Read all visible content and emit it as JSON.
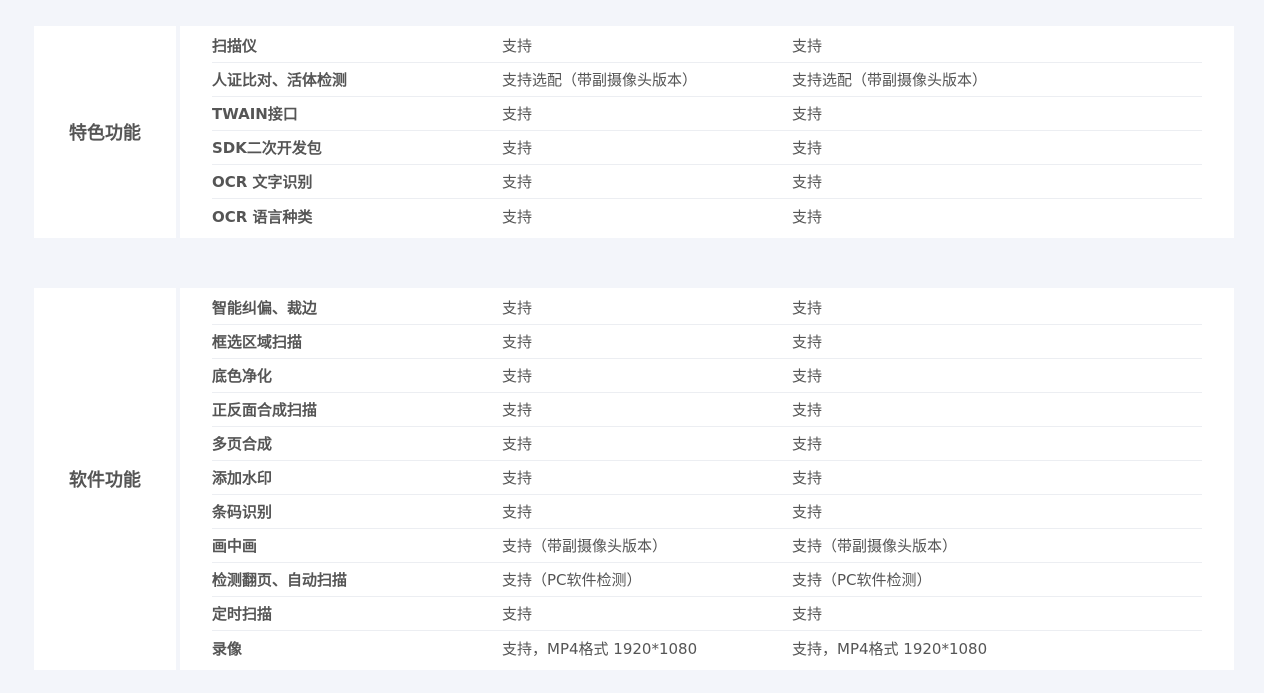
{
  "sections": [
    {
      "label": "特色功能",
      "rows": [
        {
          "name": "扫描仪",
          "a": "支持",
          "b": "支持"
        },
        {
          "name": "人证比对、活体检测",
          "a": "支持选配（带副摄像头版本）",
          "b": "支持选配（带副摄像头版本）"
        },
        {
          "name": "TWAIN接口",
          "a": "支持",
          "b": "支持"
        },
        {
          "name": "SDK二次开发包",
          "a": "支持",
          "b": "支持"
        },
        {
          "name": "OCR 文字识别",
          "a": "支持",
          "b": "支持"
        },
        {
          "name": "OCR 语言种类",
          "a": "支持",
          "b": "支持"
        }
      ]
    },
    {
      "label": "软件功能",
      "rows": [
        {
          "name": "智能纠偏、裁边",
          "a": "支持",
          "b": "支持"
        },
        {
          "name": "框选区域扫描",
          "a": "支持",
          "b": "支持"
        },
        {
          "name": "底色净化",
          "a": "支持",
          "b": "支持"
        },
        {
          "name": "正反面合成扫描",
          "a": "支持",
          "b": "支持"
        },
        {
          "name": "多页合成",
          "a": "支持",
          "b": "支持"
        },
        {
          "name": "添加水印",
          "a": "支持",
          "b": "支持"
        },
        {
          "name": "条码识别",
          "a": "支持",
          "b": "支持"
        },
        {
          "name": "画中画",
          "a": "支持（带副摄像头版本）",
          "b": "支持（带副摄像头版本）"
        },
        {
          "name": "检测翻页、自动扫描",
          "a": "支持（PC软件检测）",
          "b": "支持（PC软件检测）"
        },
        {
          "name": "定时扫描",
          "a": "支持",
          "b": "支持"
        },
        {
          "name": "录像",
          "a": "支持，MP4格式 1920*1080",
          "b": "支持，MP4格式 1920*1080"
        }
      ]
    }
  ]
}
